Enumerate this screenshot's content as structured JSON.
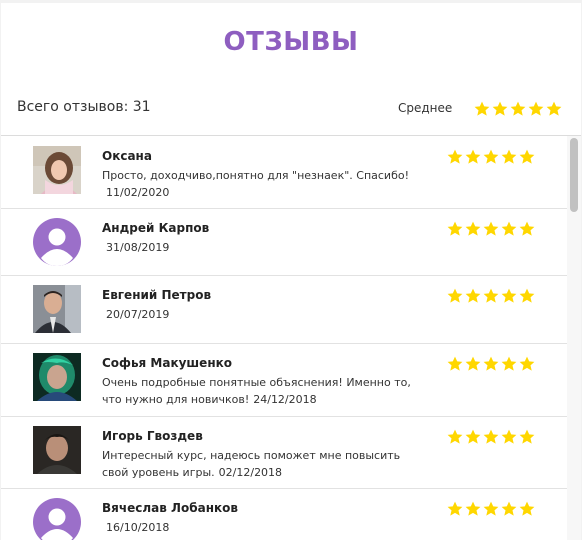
{
  "header": {
    "title": "ОТЗЫВЫ"
  },
  "summary": {
    "total_label": "Всего отзывов: 31",
    "average_label": "Среднее",
    "average_rating": 5
  },
  "colors": {
    "accent": "#8e5ec0",
    "star": "#ffd700",
    "avatar_placeholder": "#9b6fc9"
  },
  "reviews": [
    {
      "name": "Оксана",
      "text": "Просто, доходчиво,понятно для \"незнаек\". Спасибо!",
      "date": "11/02/2020",
      "rating": 5,
      "avatar": "photo-woman"
    },
    {
      "name": "Андрей Карпов",
      "text": "",
      "date": "31/08/2019",
      "rating": 5,
      "avatar": "default-user-icon"
    },
    {
      "name": "Евгений Петров",
      "text": "",
      "date": "20/07/2019",
      "rating": 5,
      "avatar": "photo-man-suit"
    },
    {
      "name": "Софья Макушенко",
      "text": "Очень подробные понятные объяснения! Именно то, что нужно для новичков!",
      "date": "24/12/2018",
      "rating": 5,
      "avatar": "photo-woman-neon"
    },
    {
      "name": "Игорь Гвоздев",
      "text": "Интересный курс, надеюсь поможет мне повысить свой уровень игры.",
      "date": "02/12/2018",
      "rating": 5,
      "avatar": "photo-man-dark"
    },
    {
      "name": "Вячеслав Лобанков",
      "text": "",
      "date": "16/10/2018",
      "rating": 5,
      "avatar": "default-user-icon"
    }
  ]
}
